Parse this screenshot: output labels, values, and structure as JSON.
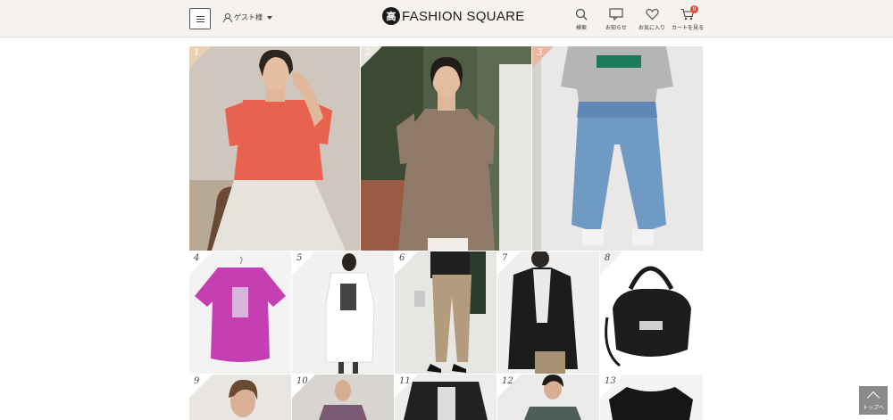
{
  "header": {
    "menu_icon": "hamburger-icon",
    "guest_label": "ゲスト様",
    "logo_mark": "高",
    "logo_text": "FASHION SQUARE",
    "actions": [
      {
        "label": "検索",
        "icon": "search-icon"
      },
      {
        "label": "お知らせ",
        "icon": "message-icon"
      },
      {
        "label": "お気に入り",
        "icon": "heart-icon"
      },
      {
        "label": "カートを見る",
        "icon": "cart-icon"
      }
    ],
    "cart_count": "0"
  },
  "ranking": {
    "top": [
      {
        "rank": "1",
        "desc": "woman in coral short-sleeve knit top with pleated skirt"
      },
      {
        "rank": "2",
        "desc": "woman in taupe polo shirt"
      },
      {
        "rank": "3",
        "desc": "grey logo tee with wide denim pants"
      }
    ],
    "row2": [
      {
        "rank": "4",
        "desc": "magenta printed tee on hanger"
      },
      {
        "rank": "5",
        "desc": "white dress with graphic"
      },
      {
        "rank": "6",
        "desc": "beige slim pants with heels"
      },
      {
        "rank": "7",
        "desc": "black leather jacket"
      },
      {
        "rank": "8",
        "desc": "black nylon tote bag"
      }
    ],
    "row3": [
      {
        "rank": "9"
      },
      {
        "rank": "10"
      },
      {
        "rank": "11"
      },
      {
        "rank": "12"
      },
      {
        "rank": "13"
      }
    ]
  },
  "to_top_label": "トップへ",
  "colors": {
    "header_bg": "#f6f2ef",
    "badge_bg": "#e9d2b4",
    "cart_badge": "#e64a3b"
  }
}
